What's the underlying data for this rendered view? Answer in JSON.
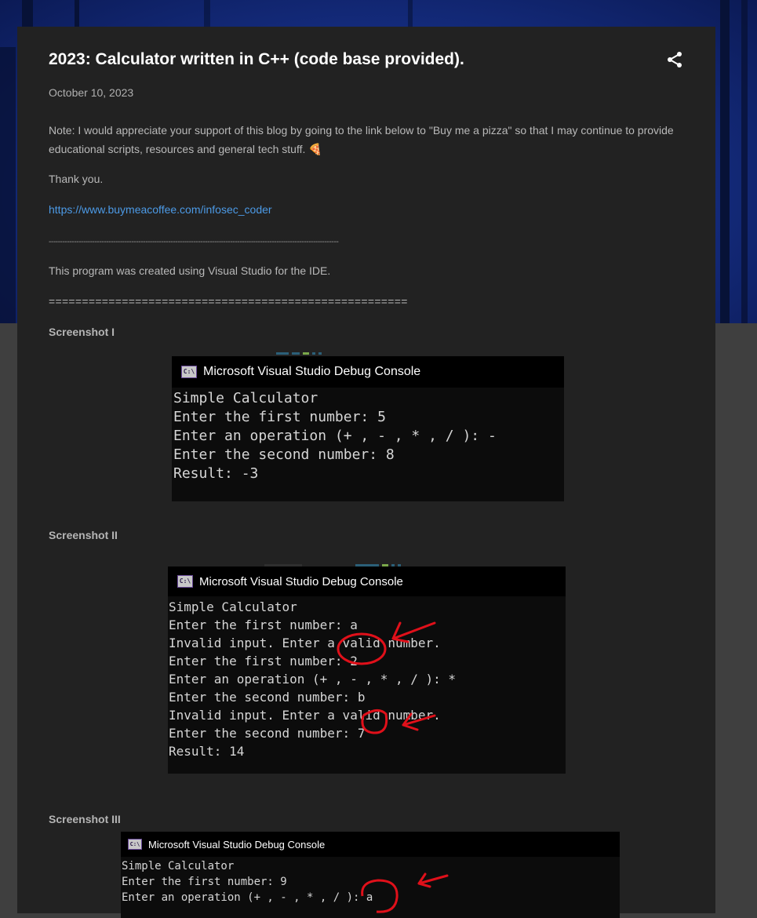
{
  "post": {
    "title": "2023: Calculator written in C++ (code base provided).",
    "date": "October 10, 2023",
    "note": " Note: I would appreciate your support of this blog by going to the link below to \"Buy me a pizza\" so that I may continue to provide educational scripts, resources and general tech stuff. 🍕",
    "thanks": "Thank you.",
    "link": "https://www.buymeacoffee.com/infosec_coder",
    "dashes": "---------------------------------------------------------------------------------------------------------------------------------------------",
    "ide_text": "This program was created using Visual Studio for the IDE.",
    "equals": "======================================================"
  },
  "screenshots": [
    {
      "label": "Screenshot I",
      "window_title": "Microsoft Visual Studio Debug Console",
      "lines": [
        "Simple Calculator",
        "Enter the first number: 5",
        "Enter an operation (+ , - , * , / ): -",
        "Enter the second number: 8",
        "Result: -3"
      ]
    },
    {
      "label": "Screenshot II",
      "window_title": "Microsoft Visual Studio Debug Console",
      "lines": [
        "Simple Calculator",
        "Enter the first number: a",
        "Invalid input. Enter a valid number.",
        "Enter the first number: 2",
        "Enter an operation (+ , - , * , / ): *",
        "Enter the second number: b",
        "Invalid input. Enter a valid number.",
        "Enter the second number: 7",
        "Result: 14"
      ]
    },
    {
      "label": "Screenshot III",
      "window_title": "Microsoft Visual Studio Debug Console",
      "lines": [
        "Simple Calculator",
        "Enter the first number: 9",
        "Enter an operation (+ , - , * , / ): a"
      ]
    }
  ],
  "icons": {
    "share": "share-icon",
    "console": "console-icon"
  },
  "colors": {
    "background": "#3f3f3f",
    "card": "#222222",
    "link": "#4c9ae6",
    "annotation": "#e0101a"
  }
}
